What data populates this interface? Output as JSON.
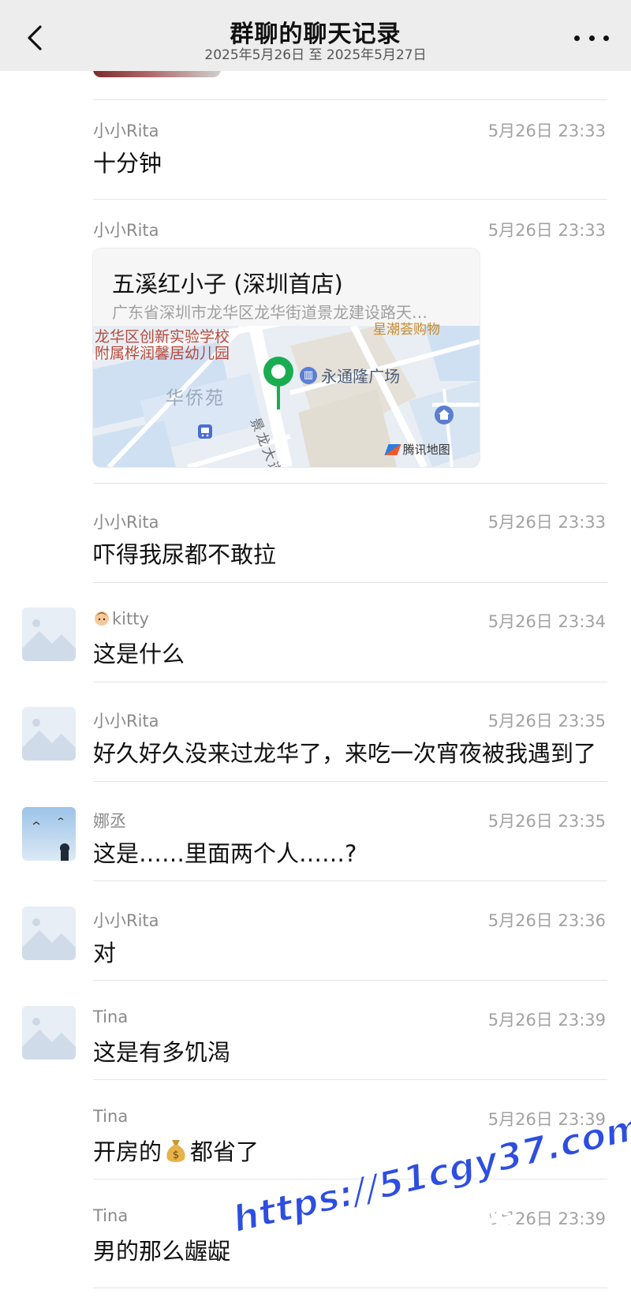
{
  "header": {
    "title": "群聊的聊天记录",
    "subtitle": "2025年5月26日 至 2025年5月27日"
  },
  "messages": [
    {
      "sender": "小小Rita",
      "time": "5月26日 23:33",
      "text": "十分钟"
    },
    {
      "sender": "小小Rita",
      "time": "5月26日 23:33"
    },
    {
      "sender": "小小Rita",
      "time": "5月26日 23:33",
      "text": "吓得我尿都不敢拉"
    },
    {
      "sender": "kitty",
      "time": "5月26日 23:34",
      "text": "这是什么"
    },
    {
      "sender": "小小Rita",
      "time": "5月26日 23:35",
      "text": "好久好久没来过龙华了，来吃一次宵夜被我遇到了"
    },
    {
      "sender": "娜丞",
      "time": "5月26日 23:35",
      "text": "这是……里面两个人……?"
    },
    {
      "sender": "小小Rita",
      "time": "5月26日 23:36",
      "text": "对"
    },
    {
      "sender": "Tina",
      "time": "5月26日 23:39",
      "text": "这是有多饥渴"
    },
    {
      "sender": "Tina",
      "time": "5月26日 23:39",
      "text_before": "开房的",
      "text_after": "都省了"
    },
    {
      "sender": "Tina",
      "time": "5月26日 23:39",
      "text": "男的那么龌龊"
    }
  ],
  "location_card": {
    "name": "五溪红小子 (深圳首店)",
    "address": "广东省深圳市龙华区龙华街道景龙建设路天…",
    "map_labels": {
      "school_line1": "龙华区创新实验学校",
      "school_line2": "附属桦润馨居幼儿园",
      "district": "华侨苑",
      "plaza": "永通隆广场",
      "road": "景龙大道",
      "top_poi": "星潮荟购物",
      "attribution": "腾讯地图"
    }
  },
  "watermark": {
    "line1": "https://51cgy37.com",
    "line2": "看完整版"
  },
  "colors": {
    "pin_green": "#1aad50",
    "watermark_blue": "#2d4ee0",
    "map_water": "#cfe0f3",
    "navbar_bg": "#ededed"
  },
  "icons": [
    "back-chevron-icon",
    "more-dots-icon",
    "map-pin-icon",
    "building-icon",
    "metro-icon",
    "house-icon",
    "tencent-map-logo-icon",
    "money-bag-icon",
    "woman-face-icon"
  ]
}
